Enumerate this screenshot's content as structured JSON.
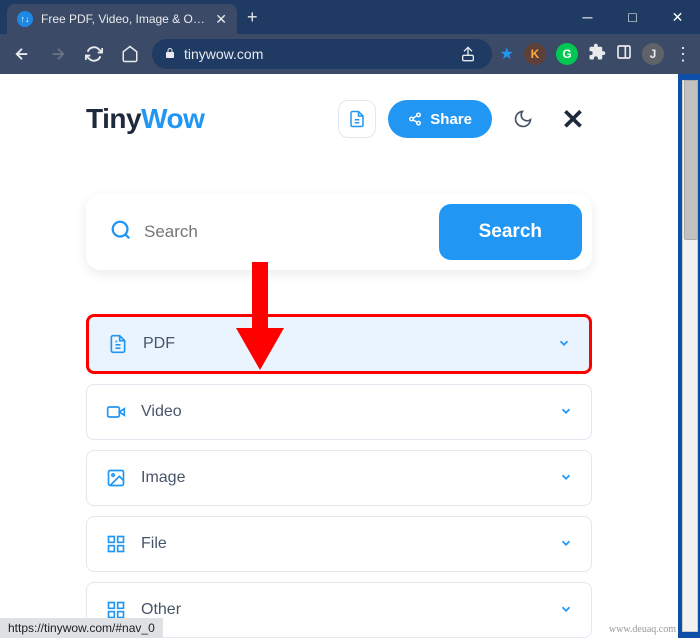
{
  "titlebar": {
    "tab_title": "Free PDF, Video, Image & Other",
    "favicon_text": "↑↓"
  },
  "toolbar": {
    "url": "tinywow.com"
  },
  "header": {
    "logo_tiny": "Tiny",
    "logo_wow": "Wow",
    "share_label": "Share"
  },
  "search": {
    "placeholder": "Search",
    "button_label": "Search"
  },
  "categories": [
    {
      "label": "PDF"
    },
    {
      "label": "Video"
    },
    {
      "label": "Image"
    },
    {
      "label": "File"
    },
    {
      "label": "Other"
    }
  ],
  "status_text": "https://tinywow.com/#nav_0",
  "watermark": "www.deuaq.com"
}
